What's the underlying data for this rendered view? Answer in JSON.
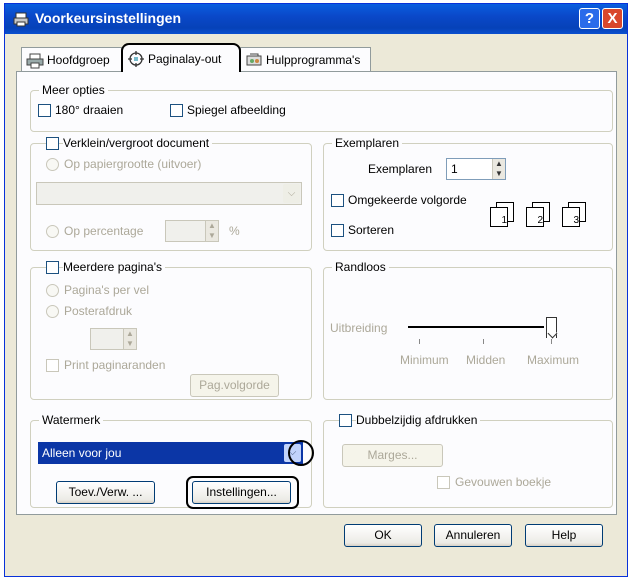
{
  "window": {
    "title": "Voorkeursinstellingen",
    "help_label": "?",
    "close_label": "X",
    "icon": "printer-icon"
  },
  "tabs": [
    {
      "label": "Hoofdgroep",
      "icon": "printer-icon"
    },
    {
      "label": "Paginalay-out",
      "icon": "page-layout-icon",
      "active": true
    },
    {
      "label": "Hulpprogramma's",
      "icon": "utility-icon"
    }
  ],
  "meer_opties": {
    "caption": "Meer opties",
    "rotate_label": "180° draaien",
    "rotate_checked": false,
    "mirror_label": "Spiegel afbeelding",
    "mirror_checked": false
  },
  "scale": {
    "checkbox_label": "Verklein/vergroot document",
    "checked": false,
    "paper_size_label": "Op papiergrootte (uitvoer)",
    "paper_size_value": "",
    "percentage_label": "Op percentage",
    "percentage_value": "",
    "percent_sign": "%"
  },
  "copies": {
    "caption": "Exemplaren",
    "label": "Exemplaren",
    "value": "1",
    "reverse_label": "Omgekeerde volgorde",
    "reverse_checked": false,
    "collate_label": "Sorteren",
    "collate_checked": false,
    "page_icons": [
      "1",
      "2",
      "3"
    ]
  },
  "multipage": {
    "checkbox_label": "Meerdere pagina's",
    "checked": false,
    "per_sheet_label": "Pagina's per vel",
    "poster_label": "Posterafdruk",
    "borders_label": "Print paginaranden",
    "order_button": "Pag.volgorde"
  },
  "borderless": {
    "caption": "Randloos",
    "expansion_label": "Uitbreiding",
    "ticks": [
      "Minimum",
      "Midden",
      "Maximum"
    ],
    "level": "Maximum"
  },
  "watermark": {
    "caption": "Watermerk",
    "selected": "Alleen voor jou",
    "add_button": "Toev./Verw. ...",
    "settings_button": "Instellingen..."
  },
  "duplex": {
    "checkbox_label": "Dubbelzijdig afdrukken",
    "checked": false,
    "margins_button": "Marges...",
    "booklet_label": "Gevouwen boekje"
  },
  "footer": {
    "ok": "OK",
    "cancel": "Annuleren",
    "help": "Help"
  },
  "colors": {
    "titlebar": "#0a4fcf",
    "face": "#ece9d8",
    "watermark_combo": "#0b36a6"
  }
}
